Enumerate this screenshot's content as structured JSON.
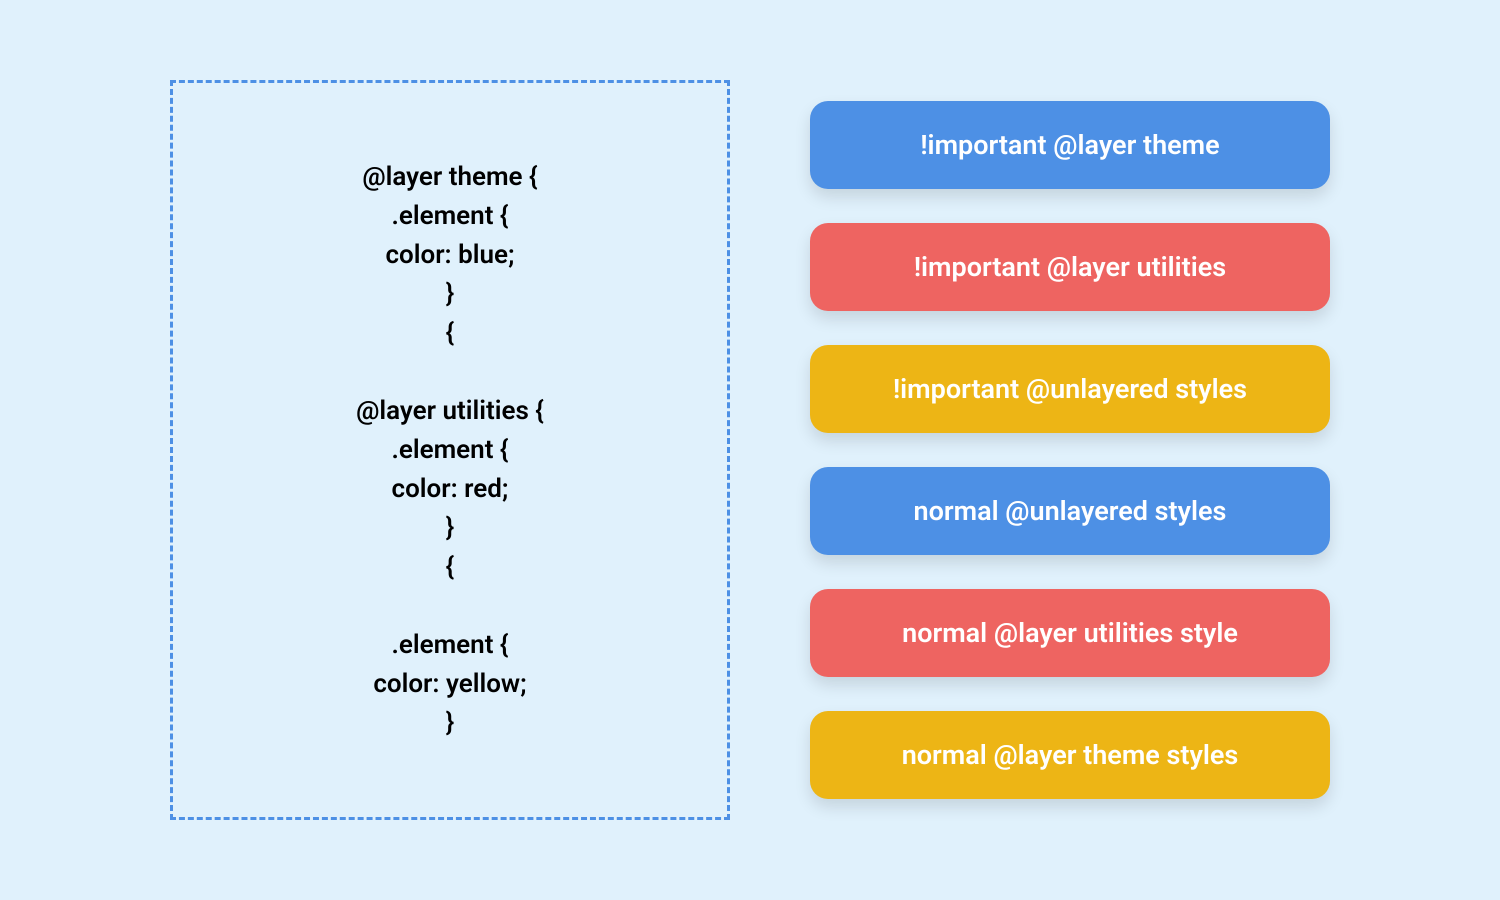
{
  "colors": {
    "blue": "#4d90e5",
    "red": "#ee6461",
    "yellow": "#edb515",
    "background": "#e0f1fc"
  },
  "code": {
    "block1_line1": "@layer theme {",
    "block1_line2": ".element {",
    "block1_line3": "color: blue;",
    "block1_line4": "}",
    "block1_line5": "{",
    "block2_line1": "@layer utilities {",
    "block2_line2": ".element {",
    "block2_line3": "color: red;",
    "block2_line4": "}",
    "block2_line5": "{",
    "block3_line1": ".element {",
    "block3_line2": "color: yellow;",
    "block3_line3": "}"
  },
  "priority": [
    {
      "label": "!important @layer theme",
      "color": "blue"
    },
    {
      "label": "!important @layer utilities",
      "color": "red"
    },
    {
      "label": "!important @unlayered styles",
      "color": "yellow"
    },
    {
      "label": "normal @unlayered styles",
      "color": "blue"
    },
    {
      "label": "normal @layer utilities style",
      "color": "red"
    },
    {
      "label": "normal @layer theme styles",
      "color": "yellow"
    }
  ]
}
